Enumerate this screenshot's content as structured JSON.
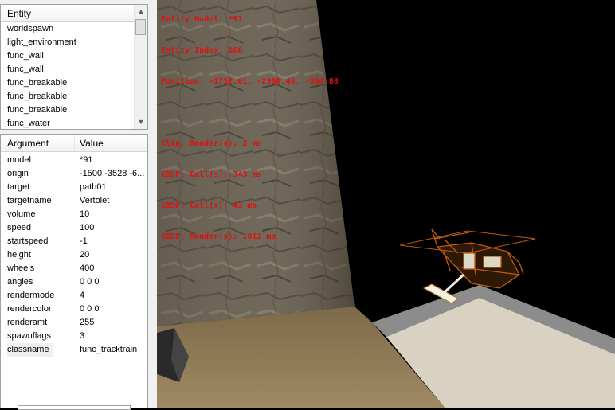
{
  "entity_panel": {
    "header": "Entity",
    "items": [
      "worldspawn",
      "light_environment",
      "func_wall",
      "func_wall",
      "func_breakable",
      "func_breakable",
      "func_breakable",
      "func_water"
    ]
  },
  "argument_panel": {
    "header_argument": "Argument",
    "header_value": "Value",
    "rows": [
      {
        "key": "model",
        "value": "*91"
      },
      {
        "key": "origin",
        "value": "-1500 -3528 -6..."
      },
      {
        "key": "target",
        "value": "path01"
      },
      {
        "key": "targetname",
        "value": "Vertolet"
      },
      {
        "key": "volume",
        "value": "10"
      },
      {
        "key": "speed",
        "value": "100"
      },
      {
        "key": "startspeed",
        "value": "-1"
      },
      {
        "key": "height",
        "value": "20"
      },
      {
        "key": "wheels",
        "value": "400"
      },
      {
        "key": "angles",
        "value": "0 0 0"
      },
      {
        "key": "rendermode",
        "value": "4"
      },
      {
        "key": "rendercolor",
        "value": "0 0 0"
      },
      {
        "key": "renderamt",
        "value": "255"
      },
      {
        "key": "spawnflags",
        "value": "3"
      },
      {
        "key": "classname",
        "value": "func_tracktrain"
      }
    ],
    "selected_row": "classname"
  },
  "viewport": {
    "hud": {
      "line1": "Entity Model: *91",
      "line2": "Entity Index: 166",
      "line3": "Position: -1752.61, -2980.46, -304.88",
      "line4": "Clip: Render(s): 2 ms",
      "line5": "CBSP: Call(s): 343 ms",
      "line6": "CBSP: Call(s): 43 ms",
      "line7": "CBSP: Render(s): 1011 ms"
    },
    "hud_color": "#e01010"
  },
  "colors": {
    "panel_bg": "#f0f0f0",
    "wireframe": "#c05a10",
    "rock": "#6e6658",
    "sand": "#8f7a56",
    "floor": "#d9d2c2"
  },
  "icons": {
    "scroll_up": "chevron-up-icon",
    "scroll_down": "chevron-down-icon"
  }
}
